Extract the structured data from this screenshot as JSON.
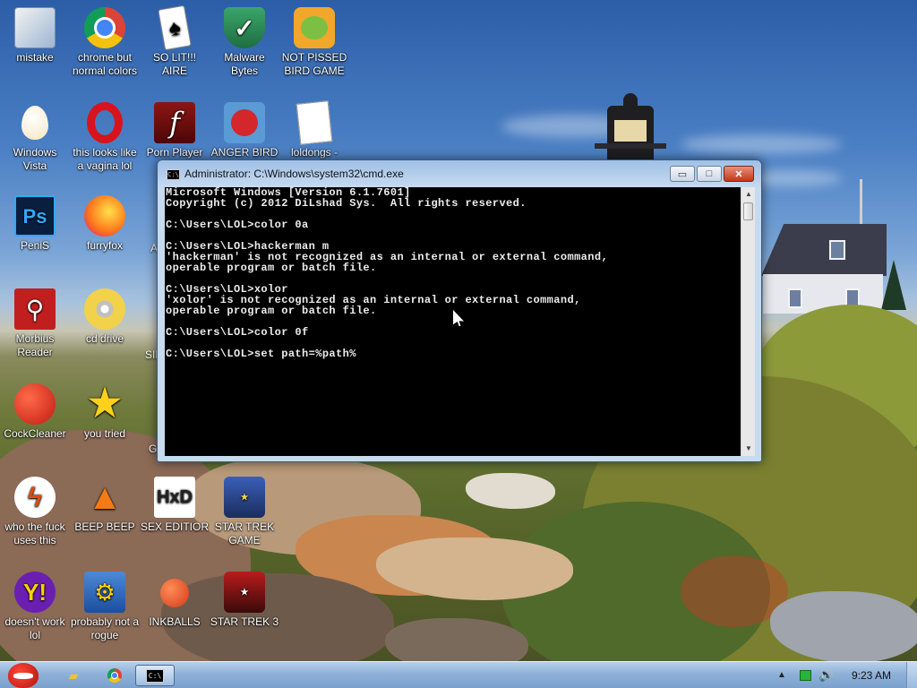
{
  "desktop": {
    "icons": [
      {
        "label": "mistake",
        "icon": "image-editor-icon"
      },
      {
        "label": "chrome but normal colors",
        "icon": "chrome-icon"
      },
      {
        "label": "SO LIT!!! AIRE",
        "icon": "solitaire-cards-icon"
      },
      {
        "label": "Malware Bytes",
        "icon": "shield-check-icon"
      },
      {
        "label": "NOT PISSED BIRD GAME",
        "icon": "green-pig-icon"
      },
      {
        "label": "Windows Vista",
        "icon": "egg-icon"
      },
      {
        "label": "this looks like a vagina lol",
        "icon": "opera-icon"
      },
      {
        "label": "Porn Player",
        "icon": "flash-player-icon"
      },
      {
        "label": "ANGER BIRD",
        "icon": "angry-bird-icon"
      },
      {
        "label": "loldongs -",
        "icon": "document-icon"
      },
      {
        "label": "PeniS",
        "icon": "photoshop-icon"
      },
      {
        "label": "furryfox",
        "icon": "firefox-icon"
      },
      {
        "label": "Morbius Reader",
        "icon": "pdf-reader-icon"
      },
      {
        "label": "cd drive",
        "icon": "cd-drive-icon"
      },
      {
        "label": "CockCleaner",
        "icon": "ccleaner-icon"
      },
      {
        "label": "you tried",
        "icon": "star-icon"
      },
      {
        "label": "who the fuck uses this",
        "icon": "lightning-icon"
      },
      {
        "label": "BEEP BEEP",
        "icon": "traffic-cone-icon"
      },
      {
        "label": "SEX EDITIOR",
        "icon": "hxd-icon"
      },
      {
        "label": "STAR TREK GAME",
        "icon": "star-wars-game-icon"
      },
      {
        "label": "doesn't work lol",
        "icon": "yahoo-messenger-icon"
      },
      {
        "label": "probably not a rogue",
        "icon": "settings-gear-icon"
      },
      {
        "label": "INKBALLS",
        "icon": "inkball-icon"
      },
      {
        "label": "STAR TREK 3",
        "icon": "star-wars-3-icon"
      }
    ],
    "partial_labels": [
      "A",
      "SIM",
      "G"
    ]
  },
  "window": {
    "title": "Administrator: C:\\Windows\\system32\\cmd.exe",
    "title_icon_text": "C:\\",
    "minimize_glyph": "▭",
    "maximize_glyph": "□",
    "close_glyph": "✕",
    "console_lines": [
      "Microsoft Windows [Version 6.1.7601]",
      "Copyright (c) 2012 DiLshad Sys.  All rights reserved.",
      "",
      "C:\\Users\\LOL>color 0a",
      "",
      "C:\\Users\\LOL>hackerman m",
      "'hackerman' is not recognized as an internal or external command,",
      "operable program or batch file.",
      "",
      "C:\\Users\\LOL>xolor",
      "'xolor' is not recognized as an internal or external command,",
      "operable program or batch file.",
      "",
      "C:\\Users\\LOL>color 0f",
      "",
      "C:\\Users\\LOL>set path=%path%"
    ],
    "scroll_up_glyph": "▲",
    "scroll_down_glyph": "▼"
  },
  "taskbar": {
    "explorer_glyph": "▰",
    "cmd_icon_text": "C:\\",
    "tray_arrow_glyph": "▲",
    "volume_glyph": "🔊",
    "clock": "9:23 AM"
  }
}
